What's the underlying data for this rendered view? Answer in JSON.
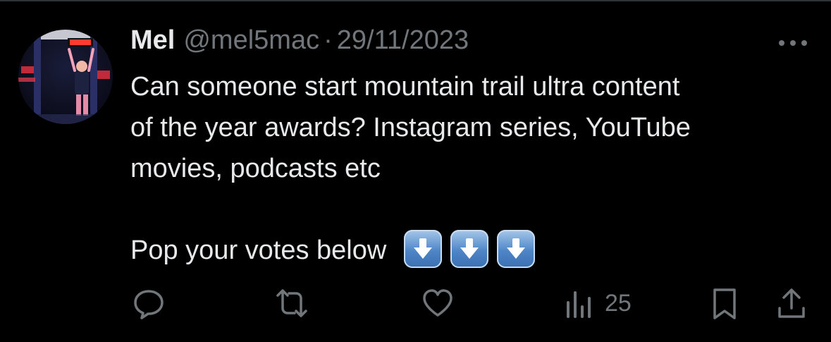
{
  "tweet": {
    "author": {
      "display_name": "Mel",
      "handle": "@mel5mac",
      "avatar_icon": "user-avatar-photo"
    },
    "separator": "·",
    "date": "29/11/2023",
    "text_lines": [
      "Can someone start mountain trail ultra content",
      "of the year awards? Instagram series, YouTube",
      "movies, podcasts etc"
    ],
    "cta_text": "Pop your votes below",
    "emojis": [
      "down-arrow-emoji",
      "down-arrow-emoji",
      "down-arrow-emoji"
    ],
    "more_icon": "more-horizontal-icon"
  },
  "actions": {
    "reply": {
      "icon": "reply-icon"
    },
    "retweet": {
      "icon": "retweet-icon"
    },
    "like": {
      "icon": "heart-icon"
    },
    "views": {
      "icon": "views-icon",
      "count": "25"
    },
    "bookmark": {
      "icon": "bookmark-icon"
    },
    "share": {
      "icon": "share-icon"
    }
  },
  "colors": {
    "background": "#000000",
    "text_primary": "#e7e9ea",
    "text_secondary": "#71767b",
    "divider": "#2f3336",
    "emoji_key": "#4f86c8"
  }
}
